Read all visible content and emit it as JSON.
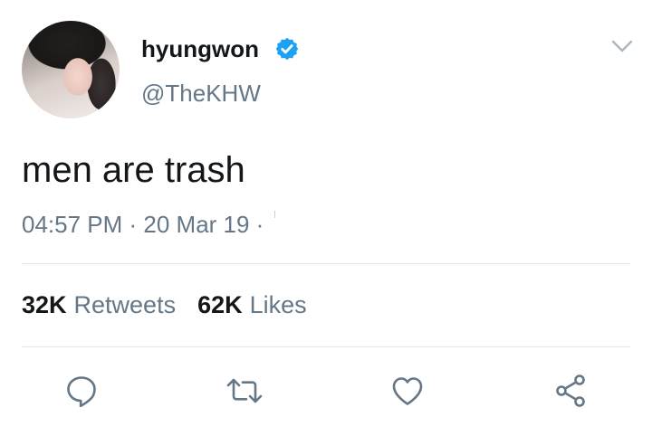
{
  "tweet": {
    "display_name": "hyungwon",
    "handle": "@TheKHW",
    "text": "men are trash",
    "timestamp": "04:57 PM · 20 Mar 19 ·",
    "stats": {
      "retweets_count": "32K",
      "retweets_label": "Retweets",
      "likes_count": "62K",
      "likes_label": "Likes"
    }
  },
  "icons": {
    "verified": "verified-badge-icon",
    "menu": "chevron-down-icon",
    "reply": "reply-bubble-icon",
    "retweet": "retweet-icon",
    "like": "heart-icon",
    "share": "share-icon"
  },
  "colors": {
    "verified_blue": "#1da1f2",
    "text_primary": "#14171a",
    "text_secondary": "#657786",
    "divider": "#e1e8ed",
    "icon_gray": "#657786"
  }
}
